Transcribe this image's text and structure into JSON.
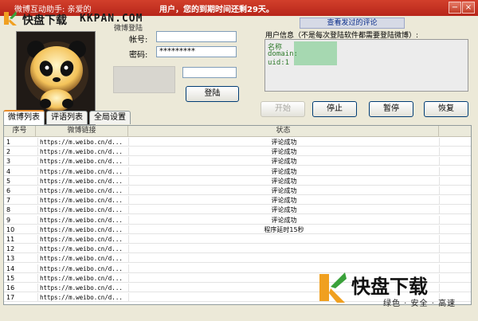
{
  "window": {
    "title": "微博互动助手: 亲爱的",
    "notice": "用户，您的到期时间还剩29天。",
    "minimize_glyph": "−",
    "close_glyph": "×"
  },
  "watermark_top": {
    "text": "快盘下载",
    "url": "KKPAN.COM"
  },
  "login": {
    "legend": "微博登陆",
    "account_label": "帐号:",
    "account_value": "",
    "password_label": "密码:",
    "password_value": "*********",
    "login_button": "登陆"
  },
  "view_comments_button": "查看发过的评论",
  "user_info": {
    "label": "用户信息（不是每次登陆软件都需要登陆微博）:",
    "lines": [
      "名称",
      "domain:",
      "uid:1"
    ]
  },
  "controls": {
    "start": "开始",
    "stop": "停止",
    "pause": "暂停",
    "resume": "恢复"
  },
  "tabs": [
    "微博列表",
    "评语列表",
    "全局设置"
  ],
  "table": {
    "headers": [
      "序号",
      "微博链接",
      "状态",
      ""
    ],
    "rows": [
      {
        "num": "1",
        "link": "https://m.weibo.cn/d...",
        "status": "评论成功"
      },
      {
        "num": "2",
        "link": "https://m.weibo.cn/d...",
        "status": "评论成功"
      },
      {
        "num": "3",
        "link": "https://m.weibo.cn/d...",
        "status": "评论成功"
      },
      {
        "num": "4",
        "link": "https://m.weibo.cn/d...",
        "status": "评论成功"
      },
      {
        "num": "5",
        "link": "https://m.weibo.cn/d...",
        "status": "评论成功"
      },
      {
        "num": "6",
        "link": "https://m.weibo.cn/d...",
        "status": "评论成功"
      },
      {
        "num": "7",
        "link": "https://m.weibo.cn/d...",
        "status": "评论成功"
      },
      {
        "num": "8",
        "link": "https://m.weibo.cn/d...",
        "status": "评论成功"
      },
      {
        "num": "9",
        "link": "https://m.weibo.cn/d...",
        "status": "评论成功"
      },
      {
        "num": "10",
        "link": "https://m.weibo.cn/d...",
        "status": "程序延时15秒"
      },
      {
        "num": "11",
        "link": "https://m.weibo.cn/d...",
        "status": ""
      },
      {
        "num": "12",
        "link": "https://m.weibo.cn/d...",
        "status": ""
      },
      {
        "num": "13",
        "link": "https://m.weibo.cn/d...",
        "status": ""
      },
      {
        "num": "14",
        "link": "https://m.weibo.cn/d...",
        "status": ""
      },
      {
        "num": "15",
        "link": "https://m.weibo.cn/d...",
        "status": ""
      },
      {
        "num": "16",
        "link": "https://m.weibo.cn/d...",
        "status": ""
      },
      {
        "num": "17",
        "link": "https://m.weibo.cn/d...",
        "status": ""
      }
    ]
  },
  "watermark_bottom": {
    "brand": "快盘下载",
    "slogan": "绿色 · 安全 · 高速"
  },
  "colors": {
    "title_bar": "#c4311f",
    "accent_green": "#2e7a2a",
    "watermark_orange": "#f0a020",
    "watermark_green": "#3aa13a"
  }
}
